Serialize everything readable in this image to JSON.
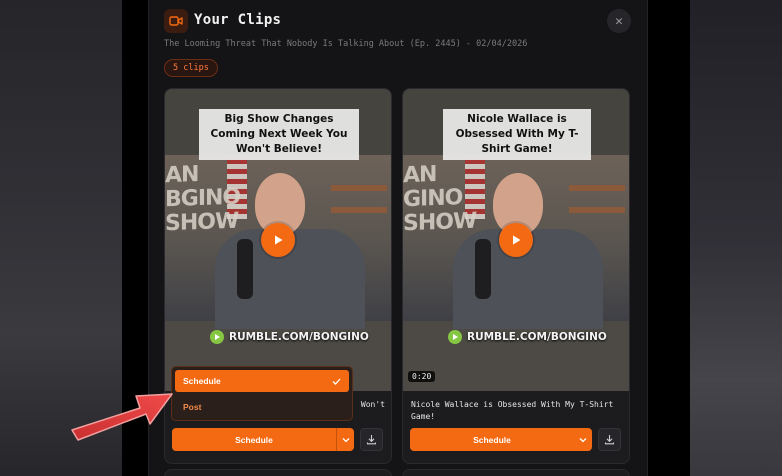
{
  "modal": {
    "title": "Your Clips",
    "subtitle": "The Looming Threat That Nobody Is Talking About (Ep. 2445) - 02/04/2026",
    "count_badge": "5 clips",
    "close_glyph": "✕"
  },
  "clips": [
    {
      "headline": "Big Show Changes Coming Next Week You Won't Believe!",
      "show_text": "AN\nBGINO\nSHOW",
      "watermark": "RUMBLE.COM/BONGINO",
      "duration": "",
      "title": "Won't",
      "schedule_label": "Schedule"
    },
    {
      "headline": "Nicole Wallace is Obsessed With My T-Shirt Game!",
      "show_text": "AN\nGINO\nSHOW",
      "watermark": "RUMBLE.COM/BONGINO",
      "duration": "0:20",
      "title": "Nicole Wallace is Obsessed With My T-Shirt Game!",
      "schedule_label": "Schedule"
    }
  ],
  "dropdown": {
    "options": [
      "Schedule",
      "Post"
    ],
    "selected": "Schedule"
  },
  "colors": {
    "accent": "#f46a12",
    "badge_text": "#ff7a3d",
    "annotation_arrow": "#e23b3b"
  },
  "icons": {
    "header": "video-camera-icon",
    "close": "close-icon",
    "play": "play-icon",
    "rumble": "rumble-logo-icon",
    "caret": "chevron-down-icon",
    "download": "download-icon",
    "check": "check-icon"
  }
}
